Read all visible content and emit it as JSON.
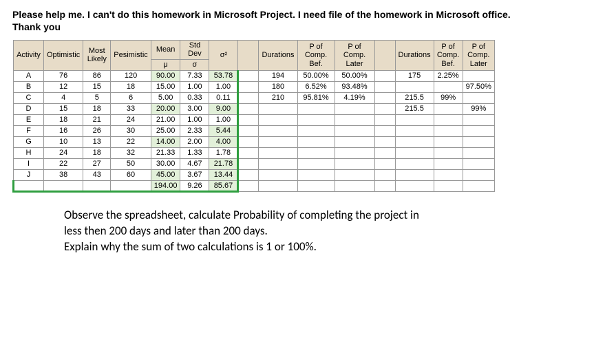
{
  "heading_line1": "Please help me. I can't do this homework in Microsoft Project. I need file of the homework in Microsoft office.",
  "heading_line2": "Thank you",
  "headers": {
    "activity": "Activity",
    "optimistic": "Optimistic",
    "most_likely": "Most Likely",
    "pesimistic": "Pesimistic",
    "mean": "Mean",
    "mu": "μ",
    "stddev": "Std Dev",
    "sigma": "σ",
    "sigma2": "σ²",
    "durations": "Durations",
    "p_comp_bef": "P of Comp. Bef.",
    "p_comp_later": "P of Comp. Later",
    "durations2": "Durations",
    "p_comp_bef2": "P of Comp. Bef.",
    "p_comp_later2": "P of Comp. Later"
  },
  "rows": [
    {
      "a": "A",
      "o": "76",
      "m": "86",
      "p": "120",
      "mean": "90.00",
      "sd": "7.33",
      "var": "53.78",
      "dur": "194",
      "pb": "50.00%",
      "pl": "50.00%",
      "dur2": "175",
      "pb2": "2.25%",
      "pl2": ""
    },
    {
      "a": "B",
      "o": "12",
      "m": "15",
      "p": "18",
      "mean": "15.00",
      "sd": "1.00",
      "var": "1.00",
      "dur": "180",
      "pb": "6.52%",
      "pl": "93.48%",
      "dur2": "",
      "pb2": "",
      "pl2": "97.50%"
    },
    {
      "a": "C",
      "o": "4",
      "m": "5",
      "p": "6",
      "mean": "5.00",
      "sd": "0.33",
      "var": "0.11",
      "dur": "210",
      "pb": "95.81%",
      "pl": "4.19%",
      "dur2": "215.5",
      "pb2": "99%",
      "pl2": ""
    },
    {
      "a": "D",
      "o": "15",
      "m": "18",
      "p": "33",
      "mean": "20.00",
      "sd": "3.00",
      "var": "9.00",
      "dur": "",
      "pb": "",
      "pl": "",
      "dur2": "215.5",
      "pb2": "",
      "pl2": "99%"
    },
    {
      "a": "E",
      "o": "18",
      "m": "21",
      "p": "24",
      "mean": "21.00",
      "sd": "1.00",
      "var": "1.00",
      "dur": "",
      "pb": "",
      "pl": "",
      "dur2": "",
      "pb2": "",
      "pl2": ""
    },
    {
      "a": "F",
      "o": "16",
      "m": "26",
      "p": "30",
      "mean": "25.00",
      "sd": "2.33",
      "var": "5.44",
      "dur": "",
      "pb": "",
      "pl": "",
      "dur2": "",
      "pb2": "",
      "pl2": ""
    },
    {
      "a": "G",
      "o": "10",
      "m": "13",
      "p": "22",
      "mean": "14.00",
      "sd": "2.00",
      "var": "4.00",
      "dur": "",
      "pb": "",
      "pl": "",
      "dur2": "",
      "pb2": "",
      "pl2": ""
    },
    {
      "a": "H",
      "o": "24",
      "m": "18",
      "p": "32",
      "mean": "21.33",
      "sd": "1.33",
      "var": "1.78",
      "dur": "",
      "pb": "",
      "pl": "",
      "dur2": "",
      "pb2": "",
      "pl2": ""
    },
    {
      "a": "I",
      "o": "22",
      "m": "27",
      "p": "50",
      "mean": "30.00",
      "sd": "4.67",
      "var": "21.78",
      "dur": "",
      "pb": "",
      "pl": "",
      "dur2": "",
      "pb2": "",
      "pl2": ""
    },
    {
      "a": "J",
      "o": "38",
      "m": "43",
      "p": "60",
      "mean": "45.00",
      "sd": "3.67",
      "var": "13.44",
      "dur": "",
      "pb": "",
      "pl": "",
      "dur2": "",
      "pb2": "",
      "pl2": ""
    }
  ],
  "totals": {
    "mean": "194.00",
    "sd": "9.26",
    "var": "85.67"
  },
  "instructions": {
    "l1": "Observe the spreadsheet, calculate Probability of completing the project in",
    "l2": "less then 200 days  and later than 200 days.",
    "l3": "Explain why the sum of two calculations is 1 or 100%."
  },
  "chart_data": {
    "type": "table",
    "title": "PERT activity estimates and completion probabilities",
    "columns": [
      "Activity",
      "Optimistic",
      "Most Likely",
      "Pesimistic",
      "Mean μ",
      "Std Dev σ",
      "σ²"
    ],
    "data": [
      [
        "A",
        76,
        86,
        120,
        90.0,
        7.33,
        53.78
      ],
      [
        "B",
        12,
        15,
        18,
        15.0,
        1.0,
        1.0
      ],
      [
        "C",
        4,
        5,
        6,
        5.0,
        0.33,
        0.11
      ],
      [
        "D",
        15,
        18,
        33,
        20.0,
        3.0,
        9.0
      ],
      [
        "E",
        18,
        21,
        24,
        21.0,
        1.0,
        1.0
      ],
      [
        "F",
        16,
        26,
        30,
        25.0,
        2.33,
        5.44
      ],
      [
        "G",
        10,
        13,
        22,
        14.0,
        2.0,
        4.0
      ],
      [
        "H",
        24,
        18,
        32,
        21.33,
        1.33,
        1.78
      ],
      [
        "I",
        22,
        27,
        50,
        30.0,
        4.67,
        21.78
      ],
      [
        "J",
        38,
        43,
        60,
        45.0,
        3.67,
        13.44
      ]
    ],
    "totals": {
      "mean": 194.0,
      "stddev": 9.26,
      "variance": 85.67
    },
    "probability_sets": [
      {
        "duration": 194,
        "p_before": 0.5,
        "p_later": 0.5
      },
      {
        "duration": 180,
        "p_before": 0.0652,
        "p_later": 0.9348
      },
      {
        "duration": 210,
        "p_before": 0.9581,
        "p_later": 0.0419
      },
      {
        "duration": 175,
        "p_before": 0.0225,
        "p_later": 0.975
      },
      {
        "duration": 215.5,
        "p_before": 0.99,
        "p_later": 0.99
      }
    ]
  }
}
